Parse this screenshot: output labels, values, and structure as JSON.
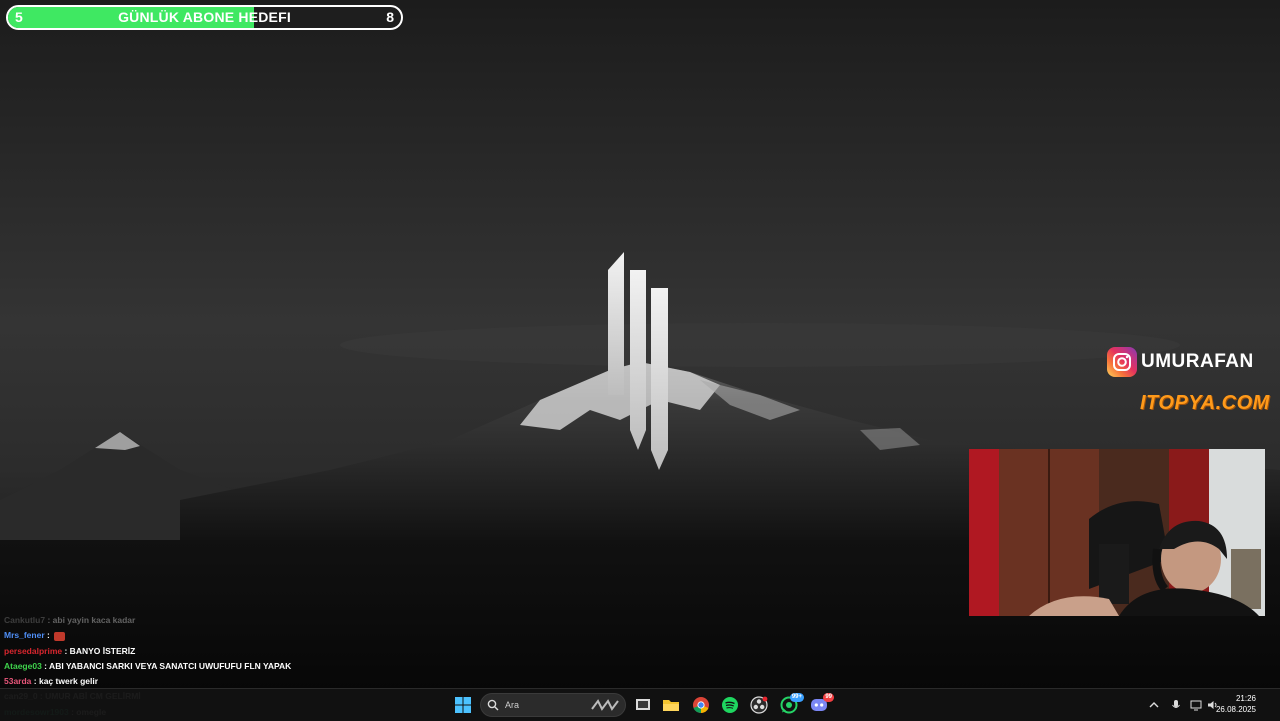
{
  "goal": {
    "current": "5",
    "target": "8",
    "title": "GÜNLÜK ABONE HEDEFI",
    "progress_fraction": 0.625,
    "fill_color": "#3fe862"
  },
  "social": {
    "instagram_handle": "UMURAFAN",
    "sponsor": "ITOPYA.COM"
  },
  "chat": [
    {
      "user": "Cankutlu7",
      "message": " : abi yayin kaca kadar",
      "color": "#9a9a9a",
      "faded": true
    },
    {
      "user": "Mrs_fener",
      "message": " : ",
      "color": "#4f8ff7",
      "emote": true
    },
    {
      "user": "persedalprime",
      "message": " : BANYO İSTERİZ",
      "color": "#d8262e"
    },
    {
      "user": "Ataege03",
      "message": " : ABI YABANCI SARKI VEYA SANATCI UWUFUFU FLN YAPAK",
      "color": "#3fd34c"
    },
    {
      "user": "53arda",
      "message": " : kaç twerk gelir",
      "color": "#e8567a"
    },
    {
      "user": "can29_0",
      "message": " : UMUR ABİ CM GELİRMİ",
      "color": "#ffffff"
    },
    {
      "user": "mordesowr1903",
      "message": " : omegle",
      "color": "#35d3a0"
    }
  ],
  "taskbar": {
    "search_placeholder": "Ara",
    "time": "21:26",
    "date": "26.08.2025",
    "whatsapp_badge": "99+",
    "discord_badge": "99"
  }
}
